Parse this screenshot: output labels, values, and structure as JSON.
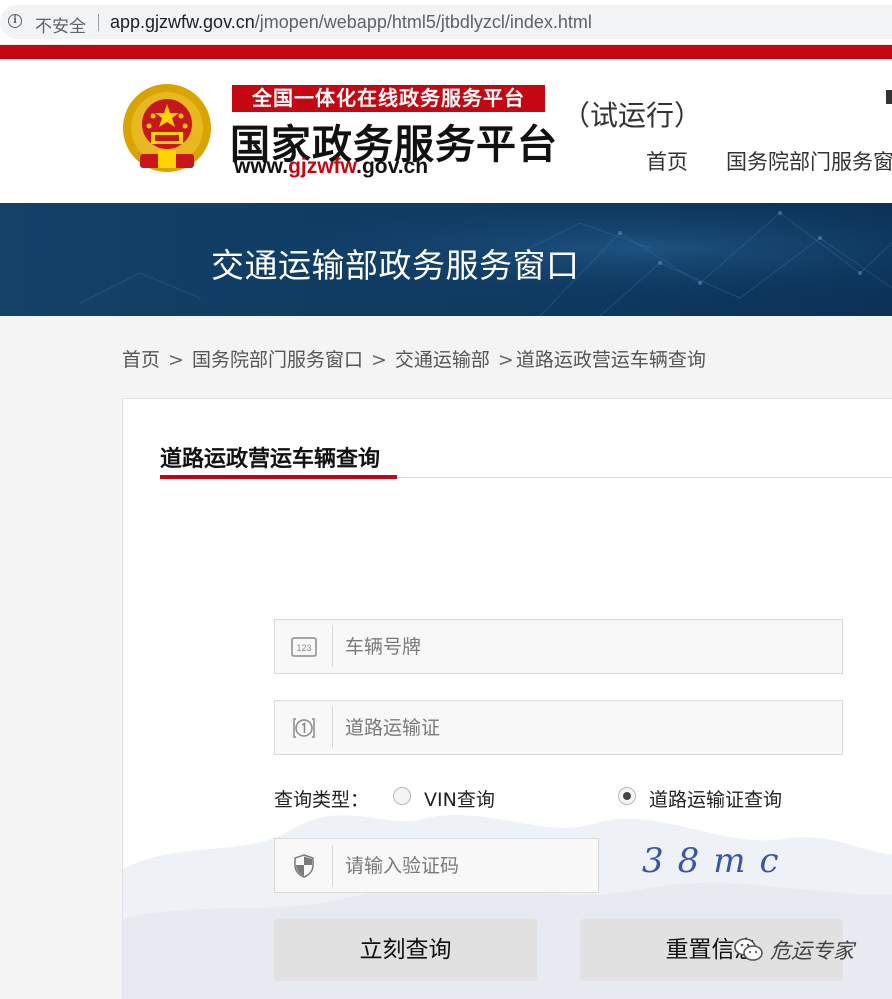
{
  "browser": {
    "security": "不安全",
    "url_host": "app.gjzwfw.gov.cn",
    "url_path": "/jmopen/webapp/html5/jtbdlyzcl/index.html"
  },
  "header": {
    "banner_text": "全国一体化在线政务服务平台",
    "platform_title": "国家政务服务平台",
    "site_url_pre": "www.",
    "site_url_mid": "gjzwfw",
    "site_url_post": ".gov.cn",
    "trial": "（试运行）",
    "nav": [
      "首页",
      "国务院部门服务窗"
    ]
  },
  "banner": {
    "title": "交通运输部政务服务窗口"
  },
  "breadcrumb": {
    "items": [
      "首页",
      "国务院部门服务窗口",
      "交通运输部",
      "道路运政营运车辆查询"
    ],
    "separator": ">"
  },
  "form": {
    "title": "道路运政营运车辆查询",
    "plate_placeholder": "车辆号牌",
    "plate_icon_text": "123",
    "license_placeholder": "道路运输证",
    "query_type_label": "查询类型：",
    "radio_vin": "VIN查询",
    "radio_license": "道路运输证查询",
    "selected": "道路运输证查询",
    "captcha_placeholder": "请输入验证码",
    "captcha_text": "38mc",
    "submit": "立刻查询",
    "reset": "重置信息"
  },
  "watermark": {
    "text": "危运专家"
  },
  "colors": {
    "brand_red": "#c40712",
    "banner_blue": "#134168"
  }
}
